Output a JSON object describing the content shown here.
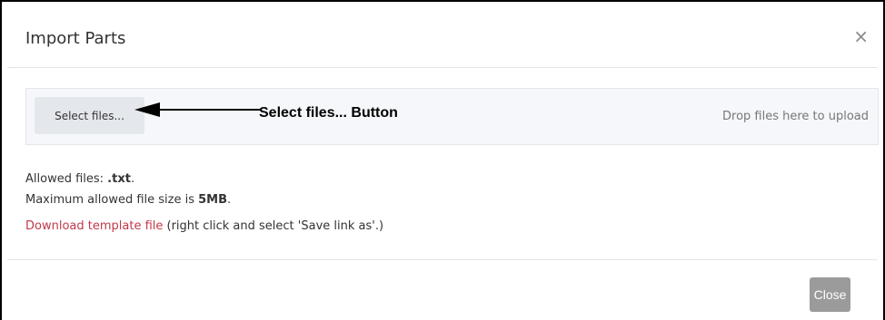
{
  "modal": {
    "title": "Import Parts",
    "close_icon": "×"
  },
  "upload": {
    "select_button": "Select files...",
    "drop_hint": "Drop files here to upload"
  },
  "annotation": {
    "label": "Select files... Button"
  },
  "info": {
    "allowed_prefix": "Allowed files: ",
    "allowed_value": ".txt",
    "allowed_suffix": ".",
    "size_prefix": "Maximum allowed file size is ",
    "size_value": "5MB",
    "size_suffix": ".",
    "download_link": "Download template file",
    "download_note": " (right click and select 'Save link as'.)"
  },
  "footer": {
    "close_button": "Close"
  },
  "colors": {
    "link": "#c0394b",
    "close_button_bg": "#9b9b9b"
  }
}
